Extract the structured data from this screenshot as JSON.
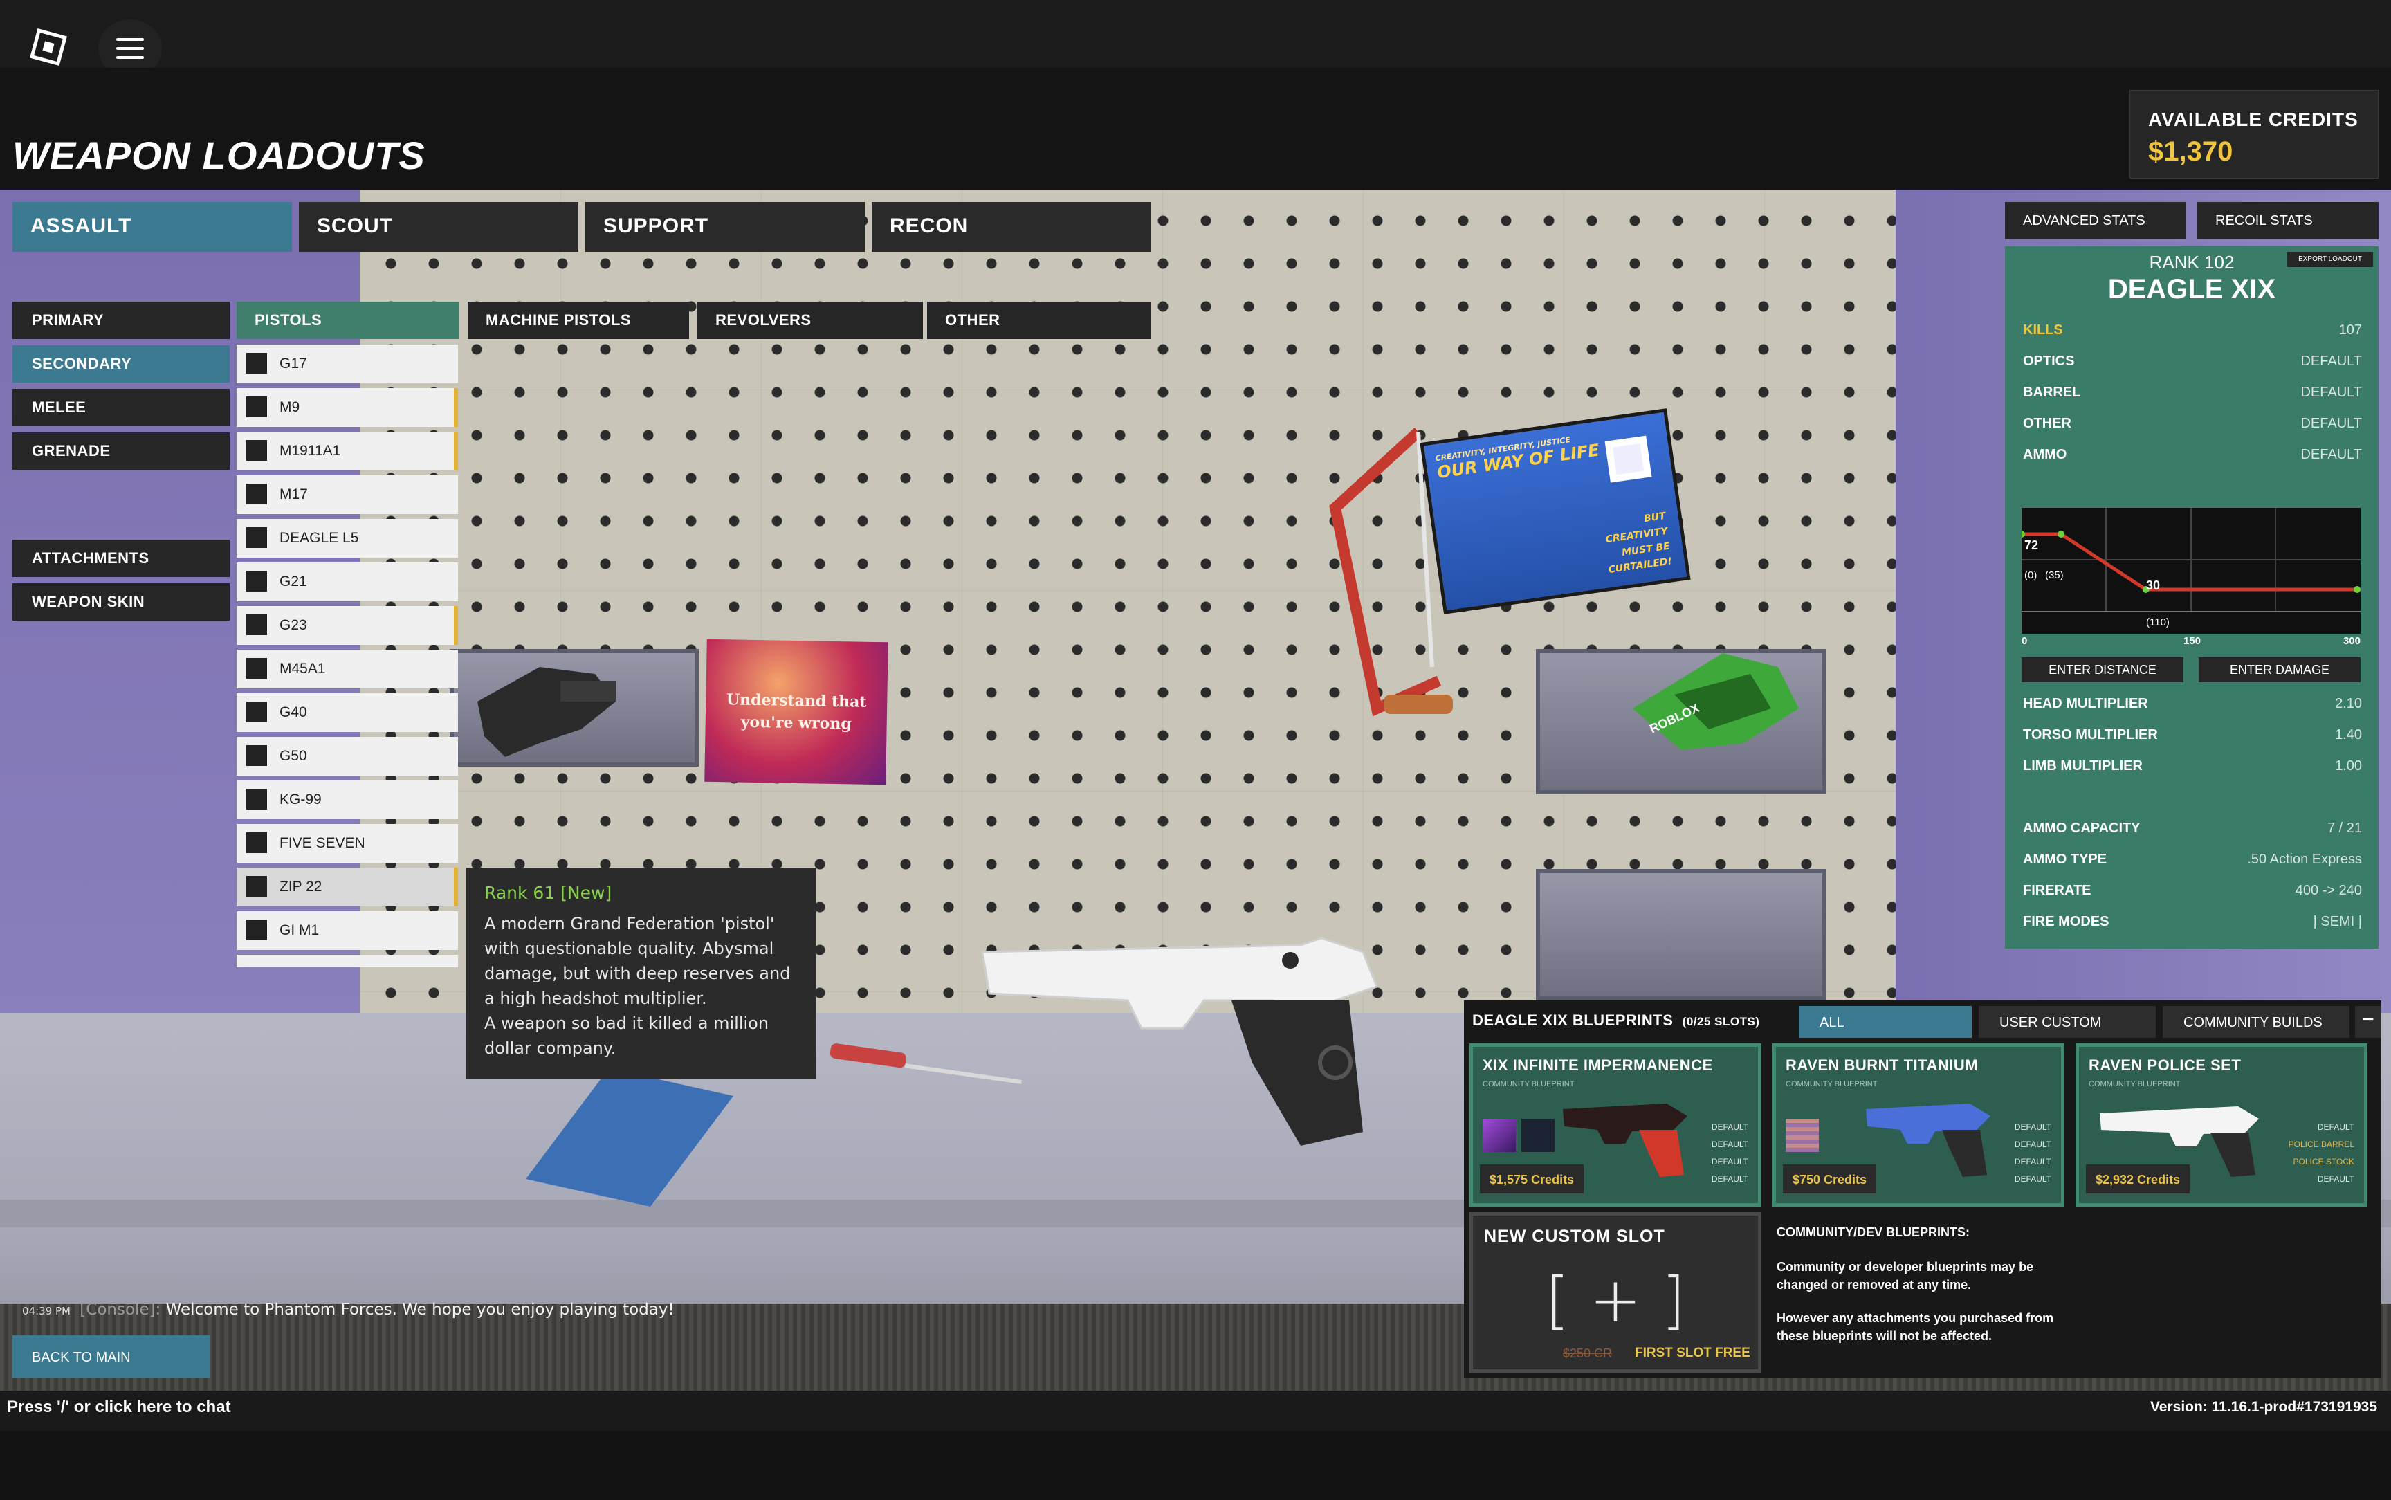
{
  "header": {
    "title": "WEAPON LOADOUTS",
    "credits_label": "AVAILABLE CREDITS",
    "credits_value": "$1,370"
  },
  "classes": [
    "ASSAULT",
    "SCOUT",
    "SUPPORT",
    "RECON"
  ],
  "slots": {
    "primary": "PRIMARY",
    "secondary": "SECONDARY",
    "melee": "MELEE",
    "grenade": "GRENADE",
    "attachments": "ATTACHMENTS",
    "weapon_skin": "WEAPON SKIN"
  },
  "subcategories": [
    "PISTOLS",
    "MACHINE PISTOLS",
    "REVOLVERS",
    "OTHER"
  ],
  "weapons": [
    "G17",
    "M9",
    "M1911A1",
    "M17",
    "DEAGLE L5",
    "G21",
    "G23",
    "M45A1",
    "G40",
    "G50",
    "KG-99",
    "FIVE SEVEN",
    "ZIP 22",
    "GI M1"
  ],
  "tooltip": {
    "title": "Rank 61 [New]",
    "desc": "A modern Grand Federation 'pistol' with questionable quality. Abysmal damage, but with deep reserves and a high headshot multiplier.",
    "desc2": "A weapon so bad it killed a million dollar company."
  },
  "scene": {
    "poster1_line1": "Understand that",
    "poster1_line2": "you're wrong",
    "poster2_small": "CREATIVITY, INTEGRITY, JUSTICE",
    "poster2_title": "OUR WAY OF LIFE",
    "poster2_but": "BUT",
    "poster2_creativity": "CREATIVITY",
    "poster2_must": "MUST BE",
    "poster2_curtailed": "CURTAILED!",
    "toy_brand": "ROBLOX"
  },
  "stats_tabs": [
    "ADVANCED STATS",
    "RECOIL STATS"
  ],
  "weapon": {
    "rank": "RANK 102",
    "name": "DEAGLE XIX",
    "export": "EXPORT LOADOUT",
    "rows": [
      {
        "label": "KILLS",
        "value": "107"
      },
      {
        "label": "OPTICS",
        "value": "DEFAULT"
      },
      {
        "label": "BARREL",
        "value": "DEFAULT"
      },
      {
        "label": "OTHER",
        "value": "DEFAULT"
      },
      {
        "label": "AMMO",
        "value": "DEFAULT"
      }
    ],
    "multipliers": [
      {
        "label": "HEAD MULTIPLIER",
        "value": "2.10"
      },
      {
        "label": "TORSO MULTIPLIER",
        "value": "1.40"
      },
      {
        "label": "LIMB MULTIPLIER",
        "value": "1.00"
      }
    ],
    "ammo": [
      {
        "label": "AMMO CAPACITY",
        "value": "7 / 21"
      },
      {
        "label": "AMMO TYPE",
        "value": ".50 Action Express"
      },
      {
        "label": "FIRERATE",
        "value": "400 -> 240"
      },
      {
        "label": "FIRE MODES",
        "value": "|  SEMI  |"
      }
    ],
    "enter_distance": "ENTER DISTANCE",
    "enter_damage": "ENTER DAMAGE"
  },
  "chart_data": {
    "type": "line",
    "x": [
      0,
      35,
      110,
      300
    ],
    "y": [
      72,
      72,
      30,
      30
    ],
    "xlim": [
      0,
      300
    ],
    "xticks": [
      "0",
      "150",
      "300"
    ],
    "labels": {
      "max_damage": "72",
      "min_damage": "30",
      "start_range": "(0)",
      "mid_range": "(35)",
      "end_range": "(110)"
    },
    "colors": {
      "line": "#d13a2b",
      "points": "#6fd13a"
    }
  },
  "blueprints": {
    "title": "DEAGLE XIX BLUEPRINTS",
    "slots": "(0/25 SLOTS)",
    "tabs": [
      "ALL",
      "USER CUSTOM",
      "COMMUNITY BUILDS"
    ],
    "close": "−",
    "cards": [
      {
        "name": "XIX INFINITE IMPERMANENCE",
        "sub": "COMMUNITY BLUEPRINT",
        "price": "$1,575 Credits",
        "att": [
          "DEFAULT",
          "DEFAULT",
          "DEFAULT",
          "DEFAULT"
        ]
      },
      {
        "name": "RAVEN BURNT TITANIUM",
        "sub": "COMMUNITY BLUEPRINT",
        "price": "$750 Credits",
        "att": [
          "DEFAULT",
          "DEFAULT",
          "DEFAULT",
          "DEFAULT"
        ]
      },
      {
        "name": "RAVEN POLICE SET",
        "sub": "COMMUNITY BLUEPRINT",
        "price": "$2,932 Credits",
        "att": [
          "DEFAULT",
          "POLICE BARREL",
          "POLICE STOCK",
          "DEFAULT"
        ]
      }
    ],
    "new_slot": {
      "title": "NEW CUSTOM SLOT",
      "plus": "[ + ]",
      "old_price": "$250 CR",
      "free": "FIRST SLOT FREE"
    },
    "note_title": "COMMUNITY/DEV BLUEPRINTS:",
    "note1": "Community or developer blueprints may be changed or removed at any time.",
    "note2": "However any attachments you purchased from these blueprints will not be affected."
  },
  "chat": {
    "time": "04:39 PM",
    "channel": "[Console]:",
    "message": "Welcome to Phantom Forces. We hope you enjoy playing today!"
  },
  "back_label": "BACK TO MAIN",
  "chat_hint": "Press '/' or click here to chat",
  "version": "Version: 11.16.1-prod#173191935",
  "colors": {
    "accent": "#3c7a92",
    "panel": "#3a7b6a",
    "gold": "#f0c53c"
  }
}
